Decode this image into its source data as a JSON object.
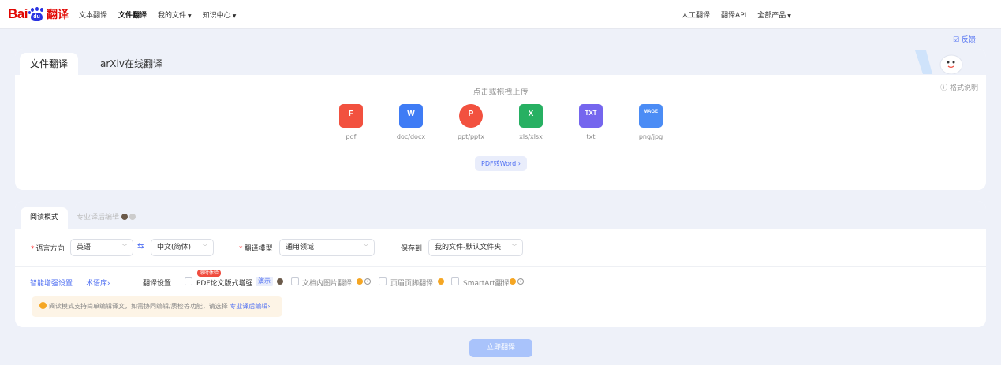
{
  "brand": {
    "bai": "Bai",
    "du": "du",
    "fanyi": "翻译"
  },
  "nav": {
    "left": [
      {
        "label": "文本翻译",
        "active": false,
        "dropdown": false
      },
      {
        "label": "文件翻译",
        "active": true,
        "dropdown": false
      },
      {
        "label": "我的文件",
        "active": false,
        "dropdown": true
      },
      {
        "label": "知识中心",
        "active": false,
        "dropdown": true
      }
    ],
    "right": [
      {
        "label": "人工翻译",
        "dropdown": false
      },
      {
        "label": "翻译API",
        "dropdown": false
      },
      {
        "label": "全部产品",
        "dropdown": true
      }
    ],
    "caret": "▼"
  },
  "feedback": {
    "icon": "edit-icon",
    "label": "☑ 反馈"
  },
  "upload": {
    "tabs": [
      "文件翻译",
      "arXiv在线翻译"
    ],
    "hint": "点击或拖拽上传",
    "format_note": "ⓘ 格式说明",
    "file_types": [
      {
        "label": "pdf",
        "icon": "pdf-icon",
        "glyph": "F",
        "color": "#f2513f"
      },
      {
        "label": "doc/docx",
        "icon": "doc-icon",
        "glyph": "W",
        "color": "#3f7cf5"
      },
      {
        "label": "ppt/pptx",
        "icon": "ppt-icon",
        "glyph": "P",
        "color": "#f2513f"
      },
      {
        "label": "xls/xlsx",
        "icon": "xls-icon",
        "glyph": "X",
        "color": "#27b062"
      },
      {
        "label": "txt",
        "icon": "txt-icon",
        "glyph": "TXT",
        "color": "#7566ee"
      },
      {
        "label": "png/jpg",
        "icon": "image-icon",
        "glyph": "MAGE",
        "color": "#4b8cf5"
      }
    ],
    "pdf_to_word": "PDF转Word ›"
  },
  "settings": {
    "tabs": {
      "active": "阅读模式",
      "other": "专业译后编辑"
    },
    "language_label": "语言方向",
    "source_lang": "英语",
    "swap": "⇆",
    "target_lang": "中文(简体)",
    "model_label": "翻译模型",
    "model_value": "通用领域",
    "save_label": "保存到",
    "save_value": "我的文件-默认文件夹",
    "arrow": "﹀",
    "smart_link": "智能增强设置",
    "term_link": "术语库›",
    "translate_settings_label": "翻译设置",
    "limited_badge": "限时体验",
    "opt_pdf_layout": "PDF论文版式增强",
    "demo_tag": "演示",
    "opt_image": "文档内图片翻译",
    "opt_header": "页眉页脚翻译",
    "opt_smartart": "SmartArt翻译",
    "notice_text": "阅读模式支持简单编辑译文，如需协同编辑/质检等功能，请选择 ",
    "notice_link": "专业译后编辑›"
  },
  "translate_button": "立即翻译",
  "colors": {
    "accent": "#4e6ef2",
    "brand_red": "#e10602",
    "brand_blue": "#2932e1",
    "button_disabled": "#a9c3fb"
  }
}
